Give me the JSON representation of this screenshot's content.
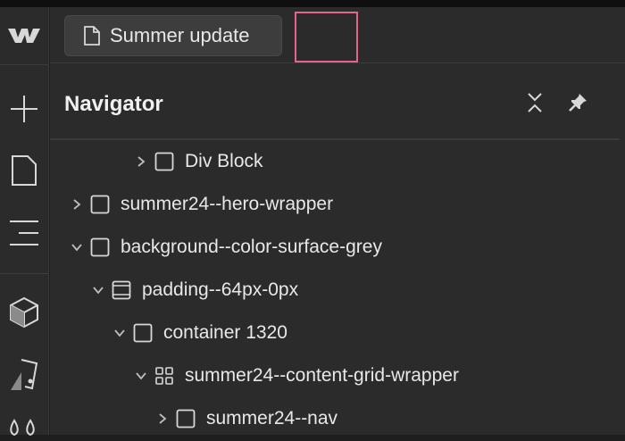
{
  "app": {
    "logo": "webflow-logo-icon"
  },
  "left_toolbar": {
    "items": [
      {
        "name": "add-icon"
      },
      {
        "name": "pages-icon"
      },
      {
        "name": "navigator-icon"
      },
      {
        "name": "components-icon"
      },
      {
        "name": "style-manager-icon"
      },
      {
        "name": "assets-icon"
      }
    ]
  },
  "page_selector": {
    "icon": "page-icon",
    "label": "Summer update"
  },
  "navigator": {
    "title": "Navigator",
    "collapse_icon": "collapse-icon",
    "pin_icon": "pin-icon",
    "tree": [
      {
        "label": "Div Block",
        "chevron": "right",
        "icon": "box-icon",
        "depth": 3
      },
      {
        "label": "summer24--hero-wrapper",
        "chevron": "right",
        "icon": "box-icon",
        "depth": 1
      },
      {
        "label": "background--color-surface-grey",
        "chevron": "down",
        "icon": "box-icon",
        "depth": 1
      },
      {
        "label": "padding--64px-0px",
        "chevron": "down",
        "icon": "section-icon",
        "depth": 2
      },
      {
        "label": "container 1320",
        "chevron": "down",
        "icon": "box-icon",
        "depth": 3
      },
      {
        "label": "summer24--content-grid-wrapper",
        "chevron": "down",
        "icon": "grid-icon",
        "depth": 4
      },
      {
        "label": "summer24--nav",
        "chevron": "right",
        "icon": "box-icon",
        "depth": 5
      }
    ]
  },
  "colors": {
    "highlight": "#e3668a",
    "panel": "#2b2b2b",
    "text": "#e8e8e8"
  }
}
